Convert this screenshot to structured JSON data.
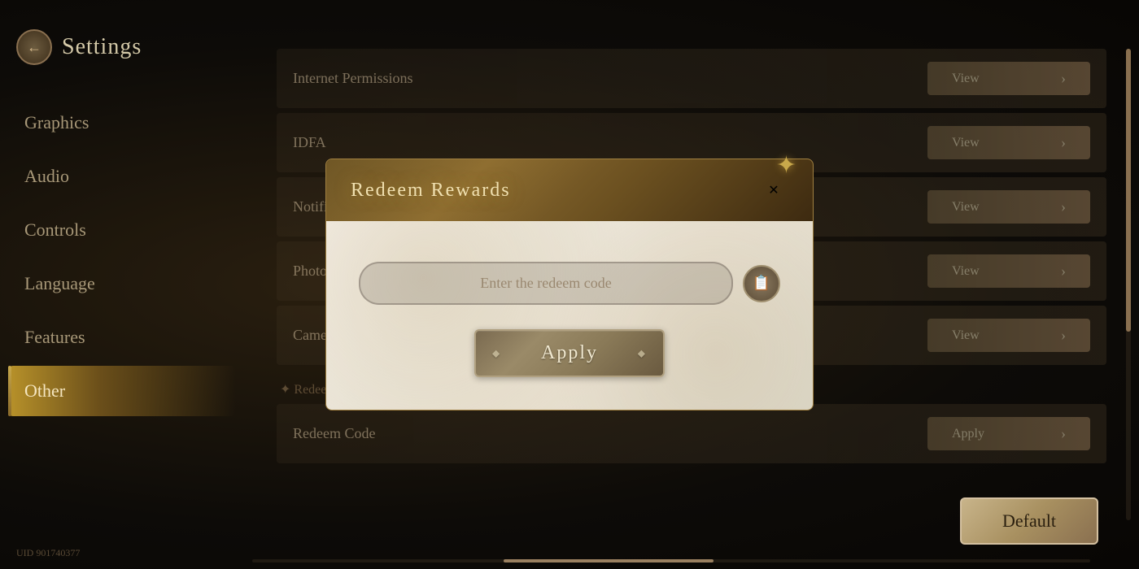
{
  "sidebar": {
    "title": "Settings",
    "back_button": "←",
    "nav_items": [
      {
        "id": "graphics",
        "label": "Graphics",
        "active": false
      },
      {
        "id": "audio",
        "label": "Audio",
        "active": false
      },
      {
        "id": "controls",
        "label": "Controls",
        "active": false
      },
      {
        "id": "language",
        "label": "Language",
        "active": false
      },
      {
        "id": "features",
        "label": "Features",
        "active": false
      },
      {
        "id": "other",
        "label": "Other",
        "active": true
      }
    ],
    "uid": "UID 901740377"
  },
  "main": {
    "settings_rows": [
      {
        "label": "Internet Permissions",
        "action": "View"
      },
      {
        "label": "IDFA",
        "action": "View"
      },
      {
        "label": "Notifications",
        "action": "View"
      },
      {
        "label": "Photo Permissions",
        "action": "View"
      },
      {
        "label": "Camera Permissions",
        "action": "View"
      }
    ],
    "redeem_section_label": "✦ Redeem Code",
    "redeem_row_label": "Redeem Code",
    "redeem_row_action": "Apply",
    "default_button": "Default"
  },
  "modal": {
    "title": "Redeem Rewards",
    "close_icon": "✕",
    "star_icon": "✦",
    "input_placeholder": "Enter the redeem code",
    "clipboard_icon": "📋",
    "apply_button": "Apply"
  }
}
